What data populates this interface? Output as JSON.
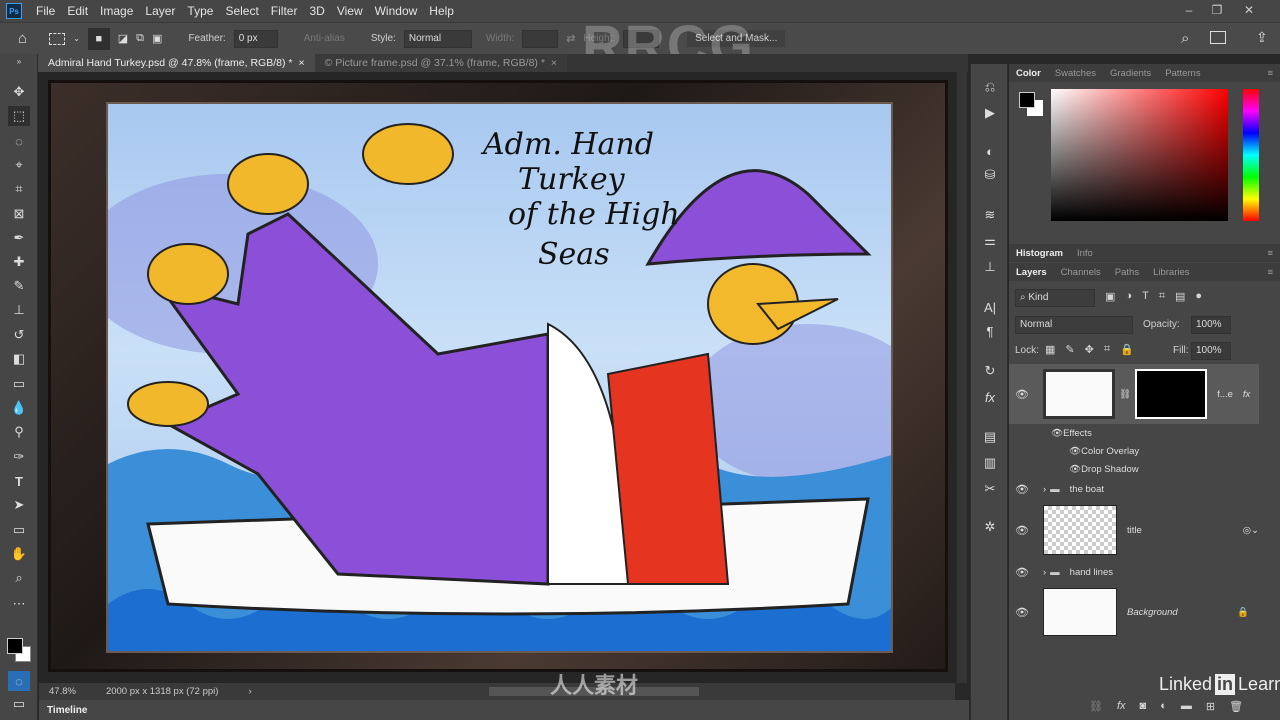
{
  "app": {
    "logo": "Ps"
  },
  "menu": [
    "File",
    "Edit",
    "Image",
    "Layer",
    "Type",
    "Select",
    "Filter",
    "3D",
    "View",
    "Window",
    "Help"
  ],
  "window_controls": {
    "minimize": "–",
    "restore": "❐",
    "close": "✕"
  },
  "options": {
    "feather_label": "Feather:",
    "feather_value": "0 px",
    "antialias_label": "Anti-alias",
    "style_label": "Style:",
    "style_value": "Normal",
    "width_label": "Width:",
    "height_label": "Height:",
    "select_mask": "Select and Mask..."
  },
  "tabs": [
    {
      "label": "Admiral Hand Turkey.psd @ 47.8% (frame, RGB/8) *",
      "active": true
    },
    {
      "label": "© Picture frame.psd @ 37.1% (frame, RGB/8) *",
      "active": false
    }
  ],
  "artwork": {
    "title_lines": [
      "Adm. Hand",
      "Turkey",
      "of the High",
      "Seas"
    ]
  },
  "status": {
    "zoom": "47.8%",
    "doc_info": "2000 px x 1318 px (72 ppi)"
  },
  "timeline_label": "Timeline",
  "color_panel": {
    "tabs": [
      "Color",
      "Swatches",
      "Gradients",
      "Patterns"
    ],
    "foreground": "#000000",
    "background": "#ffffff"
  },
  "histogram_tabs": [
    "Histogram",
    "Info"
  ],
  "layers_panel": {
    "tabs": [
      "Layers",
      "Channels",
      "Paths",
      "Libraries"
    ],
    "filter_kind": "Kind",
    "blend_mode": "Normal",
    "opacity_label": "Opacity:",
    "opacity": "100%",
    "lock_label": "Lock:",
    "fill_label": "Fill:",
    "fill": "100%",
    "layers": [
      {
        "name": "f...e",
        "fx": "fx"
      },
      {
        "name": "Effects"
      },
      {
        "name": "Color Overlay"
      },
      {
        "name": "Drop Shadow"
      },
      {
        "name": "the boat"
      },
      {
        "name": "title"
      },
      {
        "name": "hand lines"
      },
      {
        "name": "Background"
      }
    ],
    "footer_fx": "fx"
  },
  "watermarks": {
    "rrcg": "RRCG",
    "linkedin": "Linked",
    "in": "in",
    "learning": "Learning",
    "site": "人人素材"
  }
}
